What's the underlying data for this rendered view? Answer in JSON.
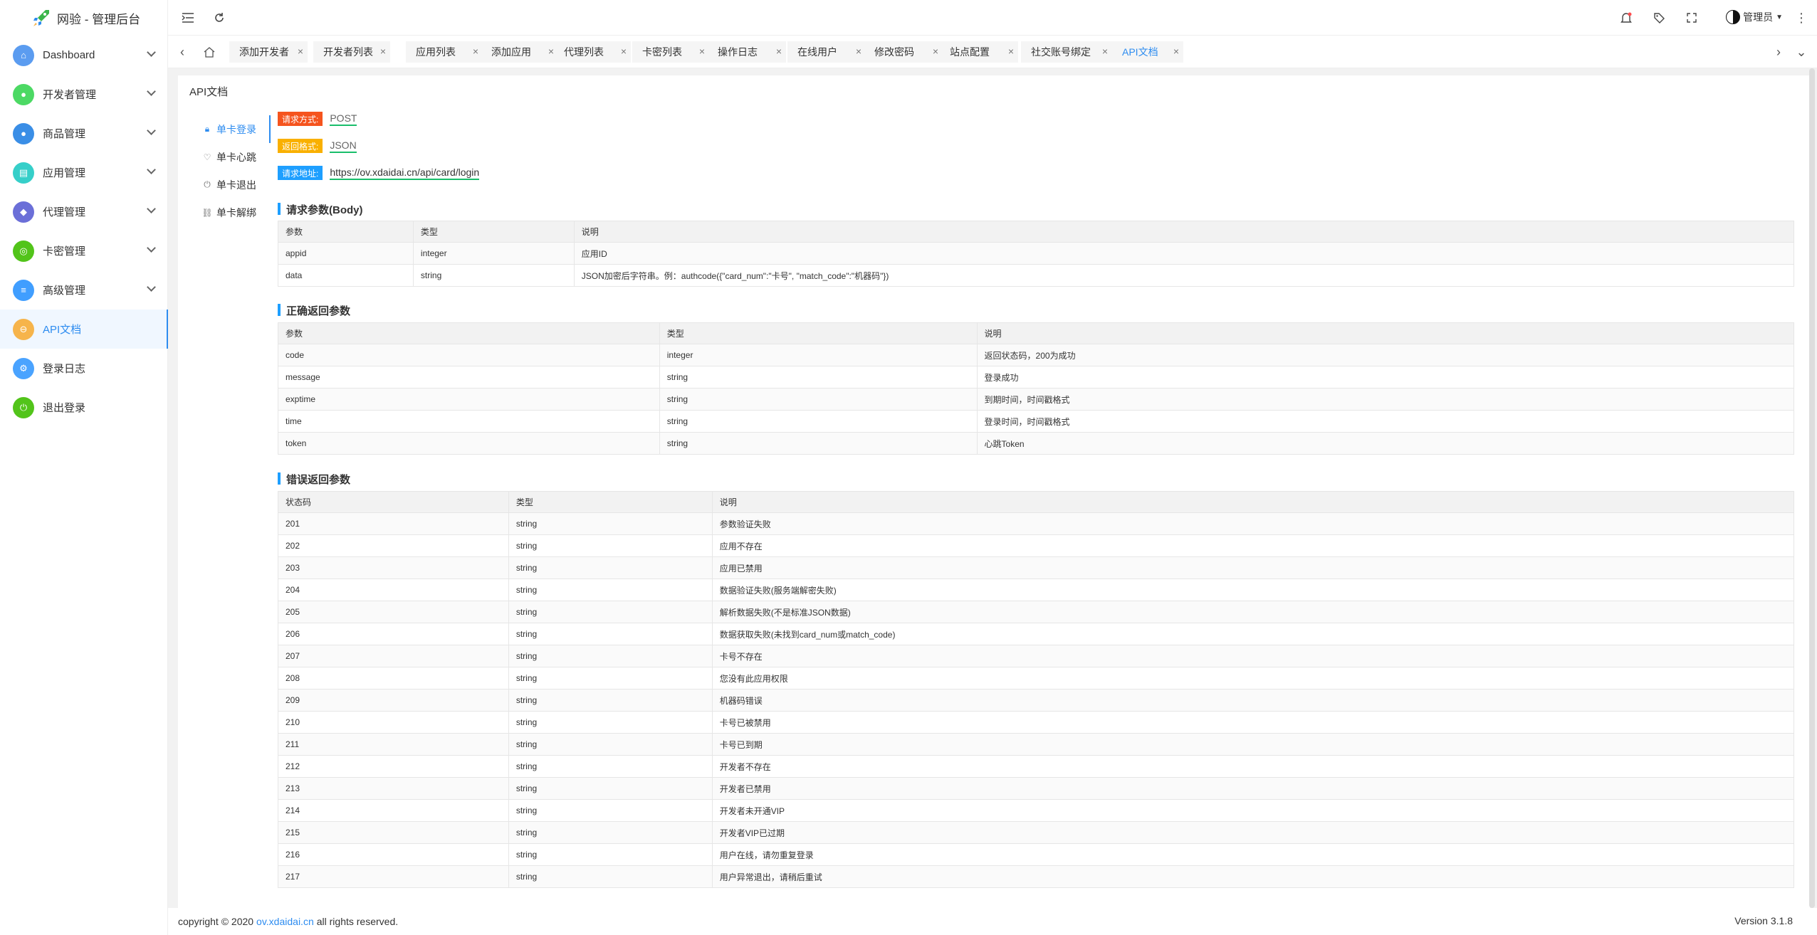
{
  "app": {
    "title": "网验 - 管理后台"
  },
  "sidebar": {
    "items": [
      {
        "label": "Dashboard",
        "icon": "home-icon",
        "color": "#5b9cf0",
        "chevron": true
      },
      {
        "label": "开发者管理",
        "icon": "user-icon",
        "color": "#4cd964",
        "chevron": true
      },
      {
        "label": "商品管理",
        "icon": "apple-icon",
        "color": "#3a8ee6",
        "chevron": true
      },
      {
        "label": "应用管理",
        "icon": "app-icon",
        "color": "#36cfc9",
        "chevron": true
      },
      {
        "label": "代理管理",
        "icon": "group-icon",
        "color": "#6b6fd8",
        "chevron": true
      },
      {
        "label": "卡密管理",
        "icon": "card-icon",
        "color": "#52c41a",
        "chevron": true
      },
      {
        "label": "高级管理",
        "icon": "sliders-icon",
        "color": "#409eff",
        "chevron": true
      },
      {
        "label": "API文档",
        "icon": "doc-icon",
        "color": "#f6b44b",
        "chevron": false,
        "active": true
      },
      {
        "label": "登录日志",
        "icon": "log-icon",
        "color": "#4aa3ff",
        "chevron": false
      },
      {
        "label": "退出登录",
        "icon": "power-icon",
        "color": "#52c41a",
        "chevron": false
      }
    ]
  },
  "header": {
    "user": "管理员"
  },
  "tabs": [
    {
      "label": "添加开发者"
    },
    {
      "label": "开发者列表"
    },
    {
      "label": "应用列表"
    },
    {
      "label": "添加应用"
    },
    {
      "label": "代理列表"
    },
    {
      "label": "卡密列表"
    },
    {
      "label": "操作日志"
    },
    {
      "label": "在线用户"
    },
    {
      "label": "修改密码"
    },
    {
      "label": "站点配置"
    },
    {
      "label": "社交账号绑定"
    },
    {
      "label": "API文档",
      "active": true
    }
  ],
  "page": {
    "title": "API文档"
  },
  "subnav": [
    {
      "label": "单卡登录",
      "icon": "lock-icon",
      "active": true
    },
    {
      "label": "单卡心跳",
      "icon": "heart-icon"
    },
    {
      "label": "单卡退出",
      "icon": "power-icon"
    },
    {
      "label": "单卡解绑",
      "icon": "unlink-icon"
    }
  ],
  "request": {
    "method_label": "请求方式:",
    "method": "POST",
    "format_label": "返回格式:",
    "format": "JSON",
    "url_label": "请求地址:",
    "url": "https://ov.xdaidai.cn/api/card/login"
  },
  "sections": {
    "body": "请求参数(Body)",
    "success": "正确返回参数",
    "error": "错误返回参数"
  },
  "body_table": {
    "headers": [
      "参数",
      "类型",
      "说明"
    ],
    "rows": [
      [
        "appid",
        "integer",
        "应用ID"
      ],
      [
        "data",
        "string",
        "JSON加密后字符串。例：authcode({\"card_num\":\"卡号\", \"match_code\":\"机器码\"})"
      ]
    ]
  },
  "success_table": {
    "headers": [
      "参数",
      "类型",
      "说明"
    ],
    "rows": [
      [
        "code",
        "integer",
        "返回状态码，200为成功"
      ],
      [
        "message",
        "string",
        "登录成功"
      ],
      [
        "exptime",
        "string",
        "到期时间，时间戳格式"
      ],
      [
        "time",
        "string",
        "登录时间，时间戳格式"
      ],
      [
        "token",
        "string",
        "心跳Token"
      ]
    ]
  },
  "error_table": {
    "headers": [
      "状态码",
      "类型",
      "说明"
    ],
    "rows": [
      [
        "201",
        "string",
        "参数验证失败"
      ],
      [
        "202",
        "string",
        "应用不存在"
      ],
      [
        "203",
        "string",
        "应用已禁用"
      ],
      [
        "204",
        "string",
        "数据验证失败(服务端解密失败)"
      ],
      [
        "205",
        "string",
        "解析数据失败(不是标准JSON数据)"
      ],
      [
        "206",
        "string",
        "数据获取失败(未找到card_num或match_code)"
      ],
      [
        "207",
        "string",
        "卡号不存在"
      ],
      [
        "208",
        "string",
        "您没有此应用权限"
      ],
      [
        "209",
        "string",
        "机器码错误"
      ],
      [
        "210",
        "string",
        "卡号已被禁用"
      ],
      [
        "211",
        "string",
        "卡号已到期"
      ],
      [
        "212",
        "string",
        "开发者不存在"
      ],
      [
        "213",
        "string",
        "开发者已禁用"
      ],
      [
        "214",
        "string",
        "开发者未开通VIP"
      ],
      [
        "215",
        "string",
        "开发者VIP已过期"
      ],
      [
        "216",
        "string",
        "用户在线，请勿重复登录"
      ],
      [
        "217",
        "string",
        "用户异常退出，请稍后重试"
      ]
    ]
  },
  "footer": {
    "prefix": "copyright © 2020",
    "link": "ov.xdaidai.cn",
    "suffix": "all rights reserved.",
    "version": "Version 3.1.8"
  }
}
